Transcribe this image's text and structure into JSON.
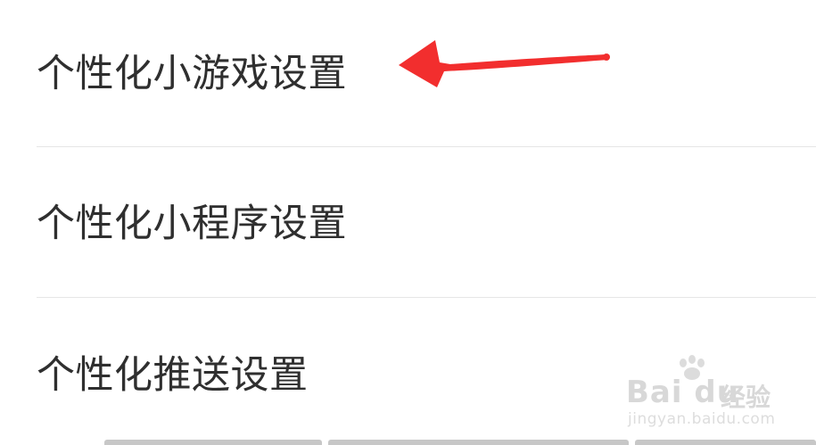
{
  "settings": {
    "items": [
      {
        "label": "个性化小游戏设置"
      },
      {
        "label": "个性化小程序设置"
      },
      {
        "label": "个性化推送设置"
      }
    ]
  },
  "annotation": {
    "arrow_icon": "red-arrow-icon",
    "arrow_color": "#f22e2e",
    "target_item": "个性化小游戏设置"
  },
  "watermark": {
    "brand": "Bai du",
    "jingyan": "经验",
    "url": "jingyan.baidu.com",
    "icon": "baidu-paw-icon"
  },
  "colors": {
    "background": "#ffffff",
    "text": "#2f2f2f",
    "divider": "#e6e6e6"
  }
}
